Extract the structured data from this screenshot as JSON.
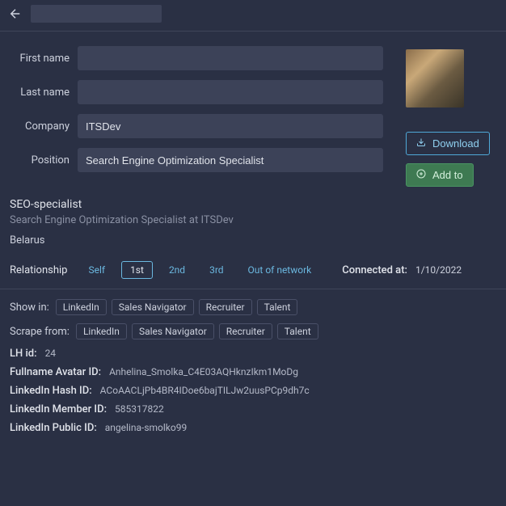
{
  "header": {
    "title": ""
  },
  "form": {
    "first_name_label": "First name",
    "first_name_value": "",
    "last_name_label": "Last name",
    "last_name_value": "",
    "company_label": "Company",
    "company_value": "ITSDev",
    "position_label": "Position",
    "position_value": "Search Engine Optimization Specialist"
  },
  "side": {
    "download_label": "Download",
    "addto_label": "Add to"
  },
  "info": {
    "role_title": "SEO-specialist",
    "role_sub": "Search Engine Optimization Specialist at ITSDev",
    "location": "Belarus"
  },
  "relationship": {
    "label": "Relationship",
    "options": [
      "Self",
      "1st",
      "2nd",
      "3rd",
      "Out of network"
    ],
    "active": "1st",
    "connected_label": "Connected at:",
    "connected_date": "1/10/2022"
  },
  "show_in": {
    "label": "Show in:",
    "options": [
      "LinkedIn",
      "Sales Navigator",
      "Recruiter",
      "Talent"
    ]
  },
  "scrape_from": {
    "label": "Scrape from:",
    "options": [
      "LinkedIn",
      "Sales Navigator",
      "Recruiter",
      "Talent"
    ]
  },
  "ids": {
    "lh_id_key": "LH id",
    "lh_id_val": "24",
    "fullname_avatar_key": "Fullname Avatar ID",
    "fullname_avatar_val": "Anhelina_Smolka_C4E03AQHknzIkm1MoDg",
    "hash_key": "LinkedIn Hash ID",
    "hash_val": "ACoAACLjPb4BR4IDoe6bajTILJw2uusPCp9dh7c",
    "member_key": "LinkedIn Member ID",
    "member_val": "585317822",
    "public_key": "LinkedIn Public ID",
    "public_val": "angelina-smolko99"
  }
}
